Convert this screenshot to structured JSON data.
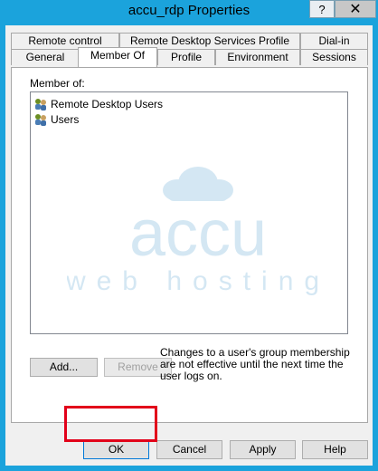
{
  "window": {
    "title": "accu_rdp Properties",
    "help_label": "?",
    "close_label": "✕"
  },
  "tabs": {
    "row1": [
      {
        "label": "Remote control"
      },
      {
        "label": "Remote Desktop Services Profile"
      },
      {
        "label": "Dial-in"
      }
    ],
    "row2": [
      {
        "label": "General"
      },
      {
        "label": "Member Of"
      },
      {
        "label": "Profile"
      },
      {
        "label": "Environment"
      },
      {
        "label": "Sessions"
      }
    ],
    "active": "Member Of"
  },
  "member_of": {
    "label": "Member of:",
    "items": [
      {
        "name": "Remote Desktop Users",
        "icon": "group-icon"
      },
      {
        "name": "Users",
        "icon": "group-icon"
      }
    ],
    "add_label": "Add...",
    "remove_label": "Remove",
    "note": "Changes to a user's group membership are not effective until the next time the user logs on."
  },
  "watermark": {
    "line1": "accu",
    "line2": "web hosting"
  },
  "footer": {
    "ok_label": "OK",
    "cancel_label": "Cancel",
    "apply_label": "Apply",
    "help_label": "Help"
  },
  "colors": {
    "title_bar": "#1ba3dc",
    "highlight": "#e2001a",
    "watermark": "#1a7fc1"
  }
}
